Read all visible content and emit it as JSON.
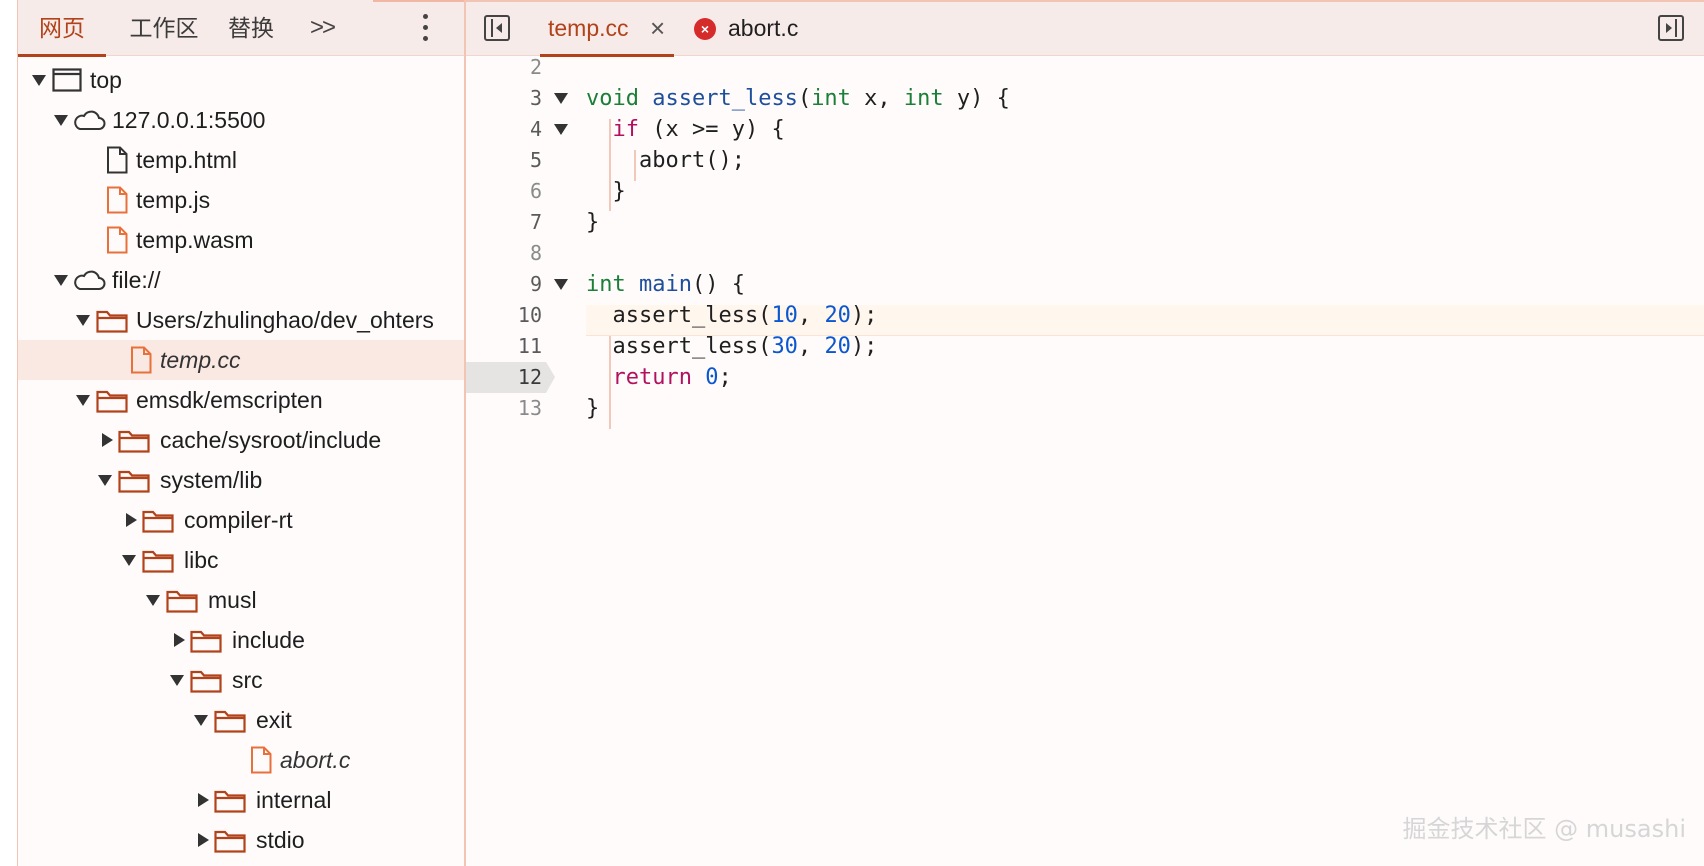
{
  "navigator": {
    "tabs": [
      {
        "label": "网页",
        "active": true
      },
      {
        "label": "工作区",
        "active": false
      },
      {
        "label": "替换",
        "active": false
      }
    ],
    "more_tabs_icon": "double-chevron-right-icon",
    "menu_icon": "kebab-menu-icon",
    "tree": [
      {
        "label": "top",
        "icon": "frame-icon",
        "expanded": true
      },
      {
        "label": "127.0.0.1:5500",
        "icon": "cloud-icon",
        "expanded": true
      },
      {
        "label": "temp.html",
        "icon": "document-icon"
      },
      {
        "label": "temp.js",
        "icon": "document-icon"
      },
      {
        "label": "temp.wasm",
        "icon": "document-icon"
      },
      {
        "label": "file://",
        "icon": "cloud-icon",
        "expanded": true
      },
      {
        "label": "Users/zhulinghao/dev_ohters",
        "icon": "folder-icon",
        "expanded": true
      },
      {
        "label": "temp.cc",
        "icon": "document-icon",
        "selected": true
      },
      {
        "label": "emsdk/emscripten",
        "icon": "folder-icon",
        "expanded": true
      },
      {
        "label": "cache/sysroot/include",
        "icon": "folder-icon",
        "expanded": false
      },
      {
        "label": "system/lib",
        "icon": "folder-icon",
        "expanded": true
      },
      {
        "label": "compiler-rt",
        "icon": "folder-icon",
        "expanded": false
      },
      {
        "label": "libc",
        "icon": "folder-icon",
        "expanded": true
      },
      {
        "label": "musl",
        "icon": "folder-icon",
        "expanded": true
      },
      {
        "label": "include",
        "icon": "folder-icon",
        "expanded": false
      },
      {
        "label": "src",
        "icon": "folder-icon",
        "expanded": true
      },
      {
        "label": "exit",
        "icon": "folder-icon",
        "expanded": true
      },
      {
        "label": "abort.c",
        "icon": "document-icon"
      },
      {
        "label": "internal",
        "icon": "folder-icon",
        "expanded": false
      },
      {
        "label": "stdio",
        "icon": "folder-icon",
        "expanded": false
      }
    ]
  },
  "editor": {
    "tabs": [
      {
        "label": "temp.cc",
        "active": true,
        "closable": true
      },
      {
        "label": "abort.c",
        "active": false,
        "error": true
      }
    ],
    "close_glyph": "×",
    "error_glyph": "×",
    "current_line": 12,
    "lines": [
      {
        "n": "2",
        "code": ""
      },
      {
        "n": "3",
        "code": "void assert_less(int x, int y) {"
      },
      {
        "n": "4",
        "code": "  if (x >= y) {"
      },
      {
        "n": "5",
        "code": "    abort();"
      },
      {
        "n": "6",
        "code": "  }"
      },
      {
        "n": "7",
        "code": "}"
      },
      {
        "n": "8",
        "code": ""
      },
      {
        "n": "9",
        "code": "int main() {"
      },
      {
        "n": "10",
        "code": "  assert_less(10, 20);"
      },
      {
        "n": "11",
        "code": "  assert_less(30, 20);"
      },
      {
        "n": "12",
        "code": "  return 0;"
      },
      {
        "n": "13",
        "code": "}"
      }
    ]
  },
  "watermark": "掘金技术社区 @ musashi",
  "colors": {
    "accent": "#b2421a",
    "tab_bar_bg": "#f7ebe9",
    "selected_row_bg": "#fae8e3",
    "type_keyword": "#1a7f37",
    "control_keyword": "#b1115e",
    "function_name": "#1e4f9c",
    "number": "#0b57d0"
  }
}
